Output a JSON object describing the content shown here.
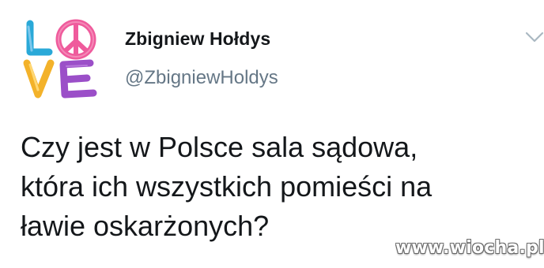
{
  "author": {
    "name": "Zbigniew Hołdys",
    "handle": "@ZbigniewHoldys",
    "avatar_text": "LOVE"
  },
  "tweet": {
    "lines": [
      "Czy jest w Polsce sala sądowa,",
      "która ich wszystkich pomieści na",
      "ławie oskarżonych?"
    ]
  },
  "watermark": "www.wiocha.pl",
  "colors": {
    "name": "#14171a",
    "handle": "#657786",
    "text": "#14171a",
    "chevron": "#aab8c2"
  },
  "icons": {
    "menu": "chevron-down-icon"
  }
}
